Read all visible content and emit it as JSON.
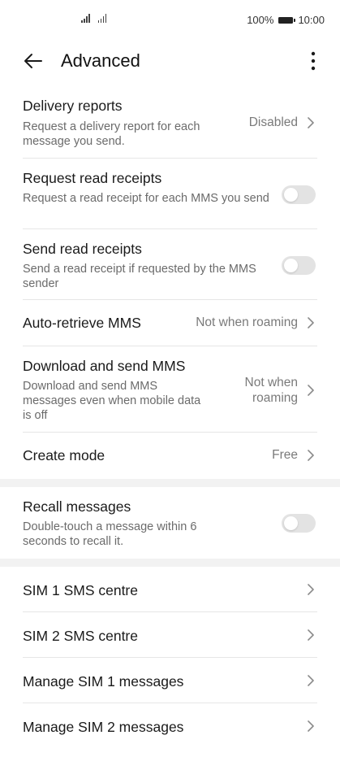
{
  "status_bar": {
    "battery": "100%",
    "time": "10:00"
  },
  "header": {
    "title": "Advanced"
  },
  "group1": [
    {
      "title": "Delivery reports",
      "subtitle": "Request a delivery report for each message you send.",
      "value": "Disabled",
      "control": "chevron"
    },
    {
      "title": "Request read receipts",
      "subtitle": "Request a read receipt for each MMS you send",
      "control": "toggle",
      "on": false
    },
    {
      "title": "Send read receipts",
      "subtitle": "Send a read receipt if requested by the MMS sender",
      "control": "toggle",
      "on": false
    },
    {
      "title": "Auto-retrieve MMS",
      "value": "Not when roaming",
      "control": "chevron"
    },
    {
      "title": "Download and send MMS",
      "subtitle": "Download and send MMS messages even when mobile data is off",
      "value_line1": "Not when",
      "value_line2": "roaming",
      "control": "chevron"
    },
    {
      "title": "Create mode",
      "value": "Free",
      "control": "chevron"
    }
  ],
  "group2": [
    {
      "title": "Recall messages",
      "subtitle": "Double-touch a message within 6 seconds to recall it.",
      "control": "toggle",
      "on": false
    }
  ],
  "group3": [
    {
      "title": "SIM 1 SMS centre",
      "control": "chevron"
    },
    {
      "title": "SIM 2 SMS centre",
      "control": "chevron"
    },
    {
      "title": "Manage SIM 1 messages",
      "control": "chevron"
    },
    {
      "title": "Manage SIM 2 messages",
      "control": "chevron"
    }
  ],
  "colors": {
    "toggle_off": "#e3e3e3",
    "section_gap": "#f2f2f2",
    "secondary_text": "#6b6b6b"
  }
}
